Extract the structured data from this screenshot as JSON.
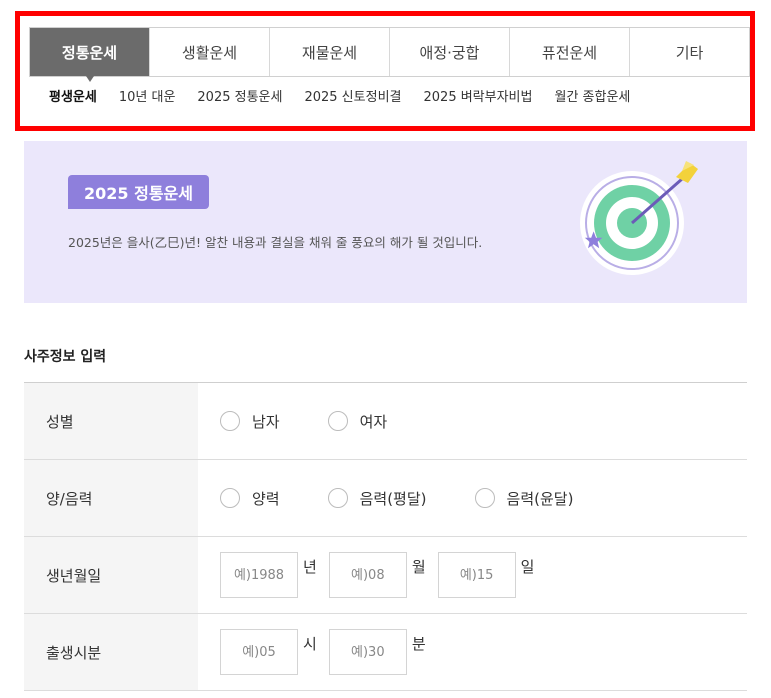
{
  "nav": {
    "tabs": [
      "정통운세",
      "생활운세",
      "재물운세",
      "애정·궁합",
      "퓨전운세",
      "기타"
    ],
    "active_tab": 0,
    "subtabs": [
      "평생운세",
      "10년 대운",
      "2025 정통운세",
      "2025 신토정비결",
      "2025 벼락부자비법",
      "월간 종합운세"
    ],
    "active_subtab": 0
  },
  "banner": {
    "badge": "2025 정통운세",
    "description": "2025년은 을사(乙巳)년! 알찬 내용과 결실을 채워 줄 풍요의 해가 될 것입니다."
  },
  "form": {
    "title": "사주정보 입력",
    "gender": {
      "label": "성별",
      "options": [
        "남자",
        "여자"
      ]
    },
    "calendar": {
      "label": "양/음력",
      "options": [
        "양력",
        "음력(평달)",
        "음력(윤달)"
      ]
    },
    "birthdate": {
      "label": "생년월일",
      "year_placeholder": "예)1988",
      "year_unit": "년",
      "month_placeholder": "예)08",
      "month_unit": "월",
      "day_placeholder": "예)15",
      "day_unit": "일"
    },
    "birthtime": {
      "label": "출생시분",
      "hour_placeholder": "예)05",
      "hour_unit": "시",
      "minute_placeholder": "예)30",
      "minute_unit": "분"
    }
  },
  "colors": {
    "highlight_border": "#ff0000",
    "active_tab_bg": "#6b6b6b",
    "banner_bg": "#ebe7fb",
    "badge_bg": "#8e7fdc",
    "target_green": "#6fd1a5",
    "arrow_yellow": "#f3d23b"
  },
  "icons": {
    "banner_art": "target-arrow-icon"
  }
}
